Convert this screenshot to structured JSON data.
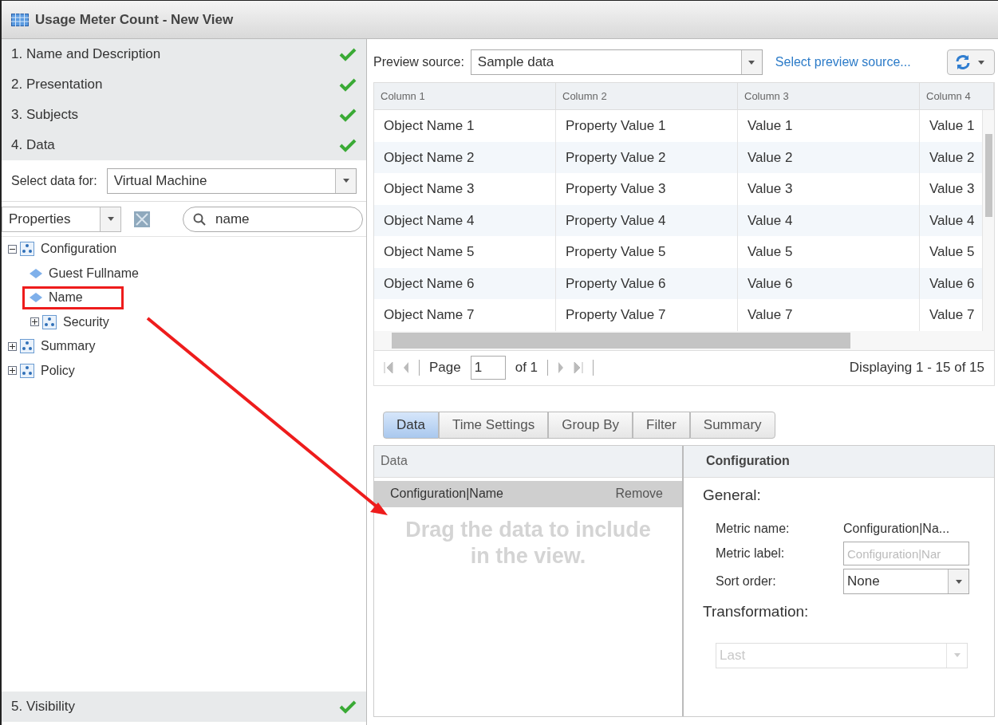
{
  "window": {
    "title": "Usage Meter Count - New View"
  },
  "steps": [
    {
      "label": "1. Name and Description",
      "done": true
    },
    {
      "label": "2. Presentation",
      "done": true
    },
    {
      "label": "3. Subjects",
      "done": true
    },
    {
      "label": "4. Data",
      "done": true
    }
  ],
  "select_data_for": {
    "label": "Select data for:",
    "value": "Virtual Machine"
  },
  "properties_filter": {
    "value": "Properties"
  },
  "search": {
    "value": "name"
  },
  "tree": [
    {
      "label": "Configuration",
      "kind": "group",
      "expanded": true,
      "children": [
        {
          "label": "Guest Fullname",
          "kind": "property",
          "highlighted": false
        },
        {
          "label": "Name",
          "kind": "property",
          "highlighted": true
        },
        {
          "label": "Security",
          "kind": "group",
          "expanded": false
        }
      ]
    },
    {
      "label": "Summary",
      "kind": "group",
      "expanded": false
    },
    {
      "label": "Policy",
      "kind": "group",
      "expanded": false
    }
  ],
  "final_step": {
    "label": "5. Visibility",
    "done": true
  },
  "preview": {
    "label": "Preview source:",
    "value": "Sample data",
    "link": "Select preview source..."
  },
  "table": {
    "columns": [
      "Column 1",
      "Column 2",
      "Column 3",
      "Column 4"
    ],
    "rows": [
      [
        "Object Name 1",
        "Property Value 1",
        "Value 1",
        "Value 1"
      ],
      [
        "Object Name 2",
        "Property Value 2",
        "Value 2",
        "Value 2"
      ],
      [
        "Object Name 3",
        "Property Value 3",
        "Value 3",
        "Value 3"
      ],
      [
        "Object Name 4",
        "Property Value 4",
        "Value 4",
        "Value 4"
      ],
      [
        "Object Name 5",
        "Property Value 5",
        "Value 5",
        "Value 5"
      ],
      [
        "Object Name 6",
        "Property Value 6",
        "Value 6",
        "Value 6"
      ],
      [
        "Object Name 7",
        "Property Value 7",
        "Value 7",
        "Value 7"
      ]
    ]
  },
  "pager": {
    "page_label": "Page",
    "page": "1",
    "of": "of 1",
    "displaying": "Displaying 1 - 15 of 15"
  },
  "tabs": [
    {
      "label": "Data",
      "selected": true
    },
    {
      "label": "Time Settings",
      "selected": false
    },
    {
      "label": "Group By",
      "selected": false
    },
    {
      "label": "Filter",
      "selected": false
    },
    {
      "label": "Summary",
      "selected": false
    }
  ],
  "data_panel": {
    "header": "Data",
    "item": "Configuration|Name",
    "remove": "Remove",
    "hint": "Drag the data to include in the view."
  },
  "config_panel": {
    "header": "Configuration",
    "general": "General:",
    "metric_name_label": "Metric name:",
    "metric_name": "Configuration|Na...",
    "metric_label_label": "Metric label:",
    "metric_label_placeholder": "Configuration|Nar",
    "sort_order_label": "Sort order:",
    "sort_order": "None",
    "transformation": "Transformation:",
    "transformation_value": "Last",
    "transformation_disabled": true
  }
}
